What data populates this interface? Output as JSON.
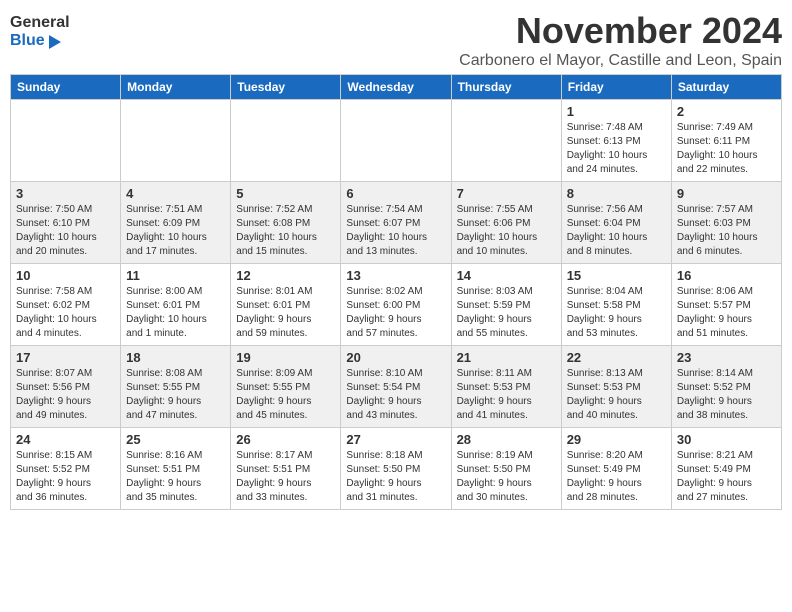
{
  "logo": {
    "line1": "General",
    "line2": "Blue"
  },
  "title": "November 2024",
  "location": "Carbonero el Mayor, Castille and Leon, Spain",
  "days_of_week": [
    "Sunday",
    "Monday",
    "Tuesday",
    "Wednesday",
    "Thursday",
    "Friday",
    "Saturday"
  ],
  "weeks": [
    {
      "shade": false,
      "days": [
        {
          "num": "",
          "info": ""
        },
        {
          "num": "",
          "info": ""
        },
        {
          "num": "",
          "info": ""
        },
        {
          "num": "",
          "info": ""
        },
        {
          "num": "",
          "info": ""
        },
        {
          "num": "1",
          "info": "Sunrise: 7:48 AM\nSunset: 6:13 PM\nDaylight: 10 hours\nand 24 minutes."
        },
        {
          "num": "2",
          "info": "Sunrise: 7:49 AM\nSunset: 6:11 PM\nDaylight: 10 hours\nand 22 minutes."
        }
      ]
    },
    {
      "shade": true,
      "days": [
        {
          "num": "3",
          "info": "Sunrise: 7:50 AM\nSunset: 6:10 PM\nDaylight: 10 hours\nand 20 minutes."
        },
        {
          "num": "4",
          "info": "Sunrise: 7:51 AM\nSunset: 6:09 PM\nDaylight: 10 hours\nand 17 minutes."
        },
        {
          "num": "5",
          "info": "Sunrise: 7:52 AM\nSunset: 6:08 PM\nDaylight: 10 hours\nand 15 minutes."
        },
        {
          "num": "6",
          "info": "Sunrise: 7:54 AM\nSunset: 6:07 PM\nDaylight: 10 hours\nand 13 minutes."
        },
        {
          "num": "7",
          "info": "Sunrise: 7:55 AM\nSunset: 6:06 PM\nDaylight: 10 hours\nand 10 minutes."
        },
        {
          "num": "8",
          "info": "Sunrise: 7:56 AM\nSunset: 6:04 PM\nDaylight: 10 hours\nand 8 minutes."
        },
        {
          "num": "9",
          "info": "Sunrise: 7:57 AM\nSunset: 6:03 PM\nDaylight: 10 hours\nand 6 minutes."
        }
      ]
    },
    {
      "shade": false,
      "days": [
        {
          "num": "10",
          "info": "Sunrise: 7:58 AM\nSunset: 6:02 PM\nDaylight: 10 hours\nand 4 minutes."
        },
        {
          "num": "11",
          "info": "Sunrise: 8:00 AM\nSunset: 6:01 PM\nDaylight: 10 hours\nand 1 minute."
        },
        {
          "num": "12",
          "info": "Sunrise: 8:01 AM\nSunset: 6:01 PM\nDaylight: 9 hours\nand 59 minutes."
        },
        {
          "num": "13",
          "info": "Sunrise: 8:02 AM\nSunset: 6:00 PM\nDaylight: 9 hours\nand 57 minutes."
        },
        {
          "num": "14",
          "info": "Sunrise: 8:03 AM\nSunset: 5:59 PM\nDaylight: 9 hours\nand 55 minutes."
        },
        {
          "num": "15",
          "info": "Sunrise: 8:04 AM\nSunset: 5:58 PM\nDaylight: 9 hours\nand 53 minutes."
        },
        {
          "num": "16",
          "info": "Sunrise: 8:06 AM\nSunset: 5:57 PM\nDaylight: 9 hours\nand 51 minutes."
        }
      ]
    },
    {
      "shade": true,
      "days": [
        {
          "num": "17",
          "info": "Sunrise: 8:07 AM\nSunset: 5:56 PM\nDaylight: 9 hours\nand 49 minutes."
        },
        {
          "num": "18",
          "info": "Sunrise: 8:08 AM\nSunset: 5:55 PM\nDaylight: 9 hours\nand 47 minutes."
        },
        {
          "num": "19",
          "info": "Sunrise: 8:09 AM\nSunset: 5:55 PM\nDaylight: 9 hours\nand 45 minutes."
        },
        {
          "num": "20",
          "info": "Sunrise: 8:10 AM\nSunset: 5:54 PM\nDaylight: 9 hours\nand 43 minutes."
        },
        {
          "num": "21",
          "info": "Sunrise: 8:11 AM\nSunset: 5:53 PM\nDaylight: 9 hours\nand 41 minutes."
        },
        {
          "num": "22",
          "info": "Sunrise: 8:13 AM\nSunset: 5:53 PM\nDaylight: 9 hours\nand 40 minutes."
        },
        {
          "num": "23",
          "info": "Sunrise: 8:14 AM\nSunset: 5:52 PM\nDaylight: 9 hours\nand 38 minutes."
        }
      ]
    },
    {
      "shade": false,
      "days": [
        {
          "num": "24",
          "info": "Sunrise: 8:15 AM\nSunset: 5:52 PM\nDaylight: 9 hours\nand 36 minutes."
        },
        {
          "num": "25",
          "info": "Sunrise: 8:16 AM\nSunset: 5:51 PM\nDaylight: 9 hours\nand 35 minutes."
        },
        {
          "num": "26",
          "info": "Sunrise: 8:17 AM\nSunset: 5:51 PM\nDaylight: 9 hours\nand 33 minutes."
        },
        {
          "num": "27",
          "info": "Sunrise: 8:18 AM\nSunset: 5:50 PM\nDaylight: 9 hours\nand 31 minutes."
        },
        {
          "num": "28",
          "info": "Sunrise: 8:19 AM\nSunset: 5:50 PM\nDaylight: 9 hours\nand 30 minutes."
        },
        {
          "num": "29",
          "info": "Sunrise: 8:20 AM\nSunset: 5:49 PM\nDaylight: 9 hours\nand 28 minutes."
        },
        {
          "num": "30",
          "info": "Sunrise: 8:21 AM\nSunset: 5:49 PM\nDaylight: 9 hours\nand 27 minutes."
        }
      ]
    }
  ]
}
